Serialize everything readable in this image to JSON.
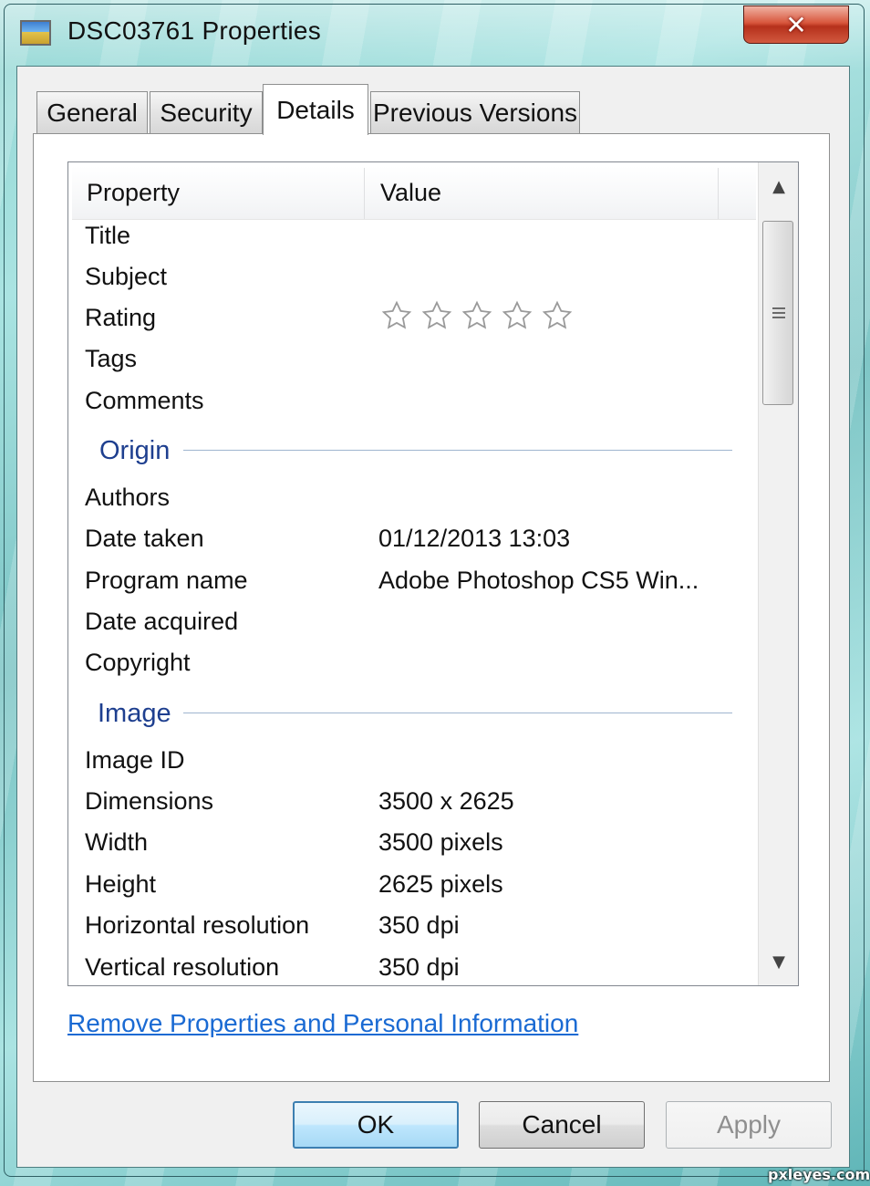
{
  "window": {
    "title": "DSC03761 Properties",
    "close_glyph": "✕"
  },
  "tabs": [
    {
      "label": "General"
    },
    {
      "label": "Security"
    },
    {
      "label": "Details",
      "active": true
    },
    {
      "label": "Previous Versions"
    }
  ],
  "details": {
    "columns": {
      "property": "Property",
      "value": "Value"
    },
    "rows": {
      "title": {
        "label": "Title",
        "value": ""
      },
      "subject": {
        "label": "Subject",
        "value": ""
      },
      "rating": {
        "label": "Rating",
        "stars_filled": 0,
        "stars_total": 5
      },
      "tags": {
        "label": "Tags",
        "value": ""
      },
      "comments": {
        "label": "Comments",
        "value": ""
      }
    },
    "origin": {
      "heading": "Origin",
      "authors": {
        "label": "Authors",
        "value": ""
      },
      "date_taken": {
        "label": "Date taken",
        "value": "01/12/2013 13:03"
      },
      "program_name": {
        "label": "Program name",
        "value": "Adobe Photoshop CS5 Win..."
      },
      "date_acquired": {
        "label": "Date acquired",
        "value": ""
      },
      "copyright": {
        "label": "Copyright",
        "value": ""
      }
    },
    "image": {
      "heading": "Image",
      "image_id": {
        "label": "Image ID",
        "value": ""
      },
      "dimensions": {
        "label": "Dimensions",
        "value": "3500 x 2625"
      },
      "width": {
        "label": "Width",
        "value": "3500 pixels"
      },
      "height": {
        "label": "Height",
        "value": "2625 pixels"
      },
      "horizontal_resolution": {
        "label": "Horizontal resolution",
        "value": "350 dpi"
      },
      "vertical_resolution": {
        "label": "Vertical resolution",
        "value": "350 dpi"
      }
    }
  },
  "link": {
    "label": "Remove Properties and Personal Information"
  },
  "buttons": {
    "ok": "OK",
    "cancel": "Cancel",
    "apply": "Apply"
  },
  "watermark": "pxleyes.com",
  "icons": {
    "window_icon": "image-file-icon",
    "close": "close-icon",
    "star": "star-outline-icon",
    "scroll_up": "scroll-up-arrow-icon",
    "scroll_down": "scroll-down-arrow-icon"
  },
  "colors": {
    "group_heading": "#1e3f8f",
    "link": "#1a6ad3",
    "close_button": "#c9452d",
    "default_button_border": "#3c7fb1"
  }
}
